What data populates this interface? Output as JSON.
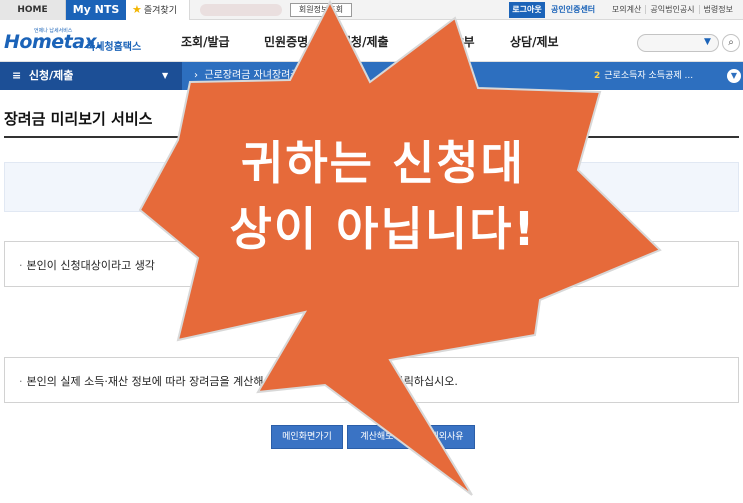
{
  "topbar": {
    "home_tab": "HOME",
    "mynts_tab": "My NTS",
    "favorites_tab": "즐겨찾기",
    "member_info_button": "회원정보조회",
    "logout_button": "로그아웃",
    "certificate_center": "공인인증센터",
    "util_links": [
      "모의계산",
      "공익법인공시",
      "법령정보"
    ]
  },
  "header": {
    "logo_tagline": "언제나 납세서비스",
    "logo_text": "Hometax.",
    "logo_korean": "국세청홈택스",
    "nav": [
      "조회/발급",
      "민원증명",
      "신청/제출",
      "신고/납부",
      "상담/제보"
    ]
  },
  "menubar": {
    "section": "신청/제출",
    "breadcrumb": "근로장려금 자녀장려금 신청",
    "step_number": "2",
    "step_label": "근로소득자 소득공제 ..."
  },
  "content": {
    "page_title": "장려금 미리보기 서비스",
    "notice_1": "본인이 신청대상이라고 생각",
    "notice_2": "본인의 실제 소득·재산 정보에 따라 장려금을 계산해 보시려면『계산해보기』를 클릭하십시오."
  },
  "buttons": {
    "main_page": "메인화면가기",
    "calculate": "계산해보기",
    "exclusion_reason": "제외사유"
  },
  "overlay": {
    "line1": "귀하는 신청대",
    "line2": "상이 아닙니다!"
  },
  "colors": {
    "brand_blue": "#1b63b8",
    "menu_blue": "#2d6fbf",
    "balloon_orange": "#e66a3a"
  }
}
